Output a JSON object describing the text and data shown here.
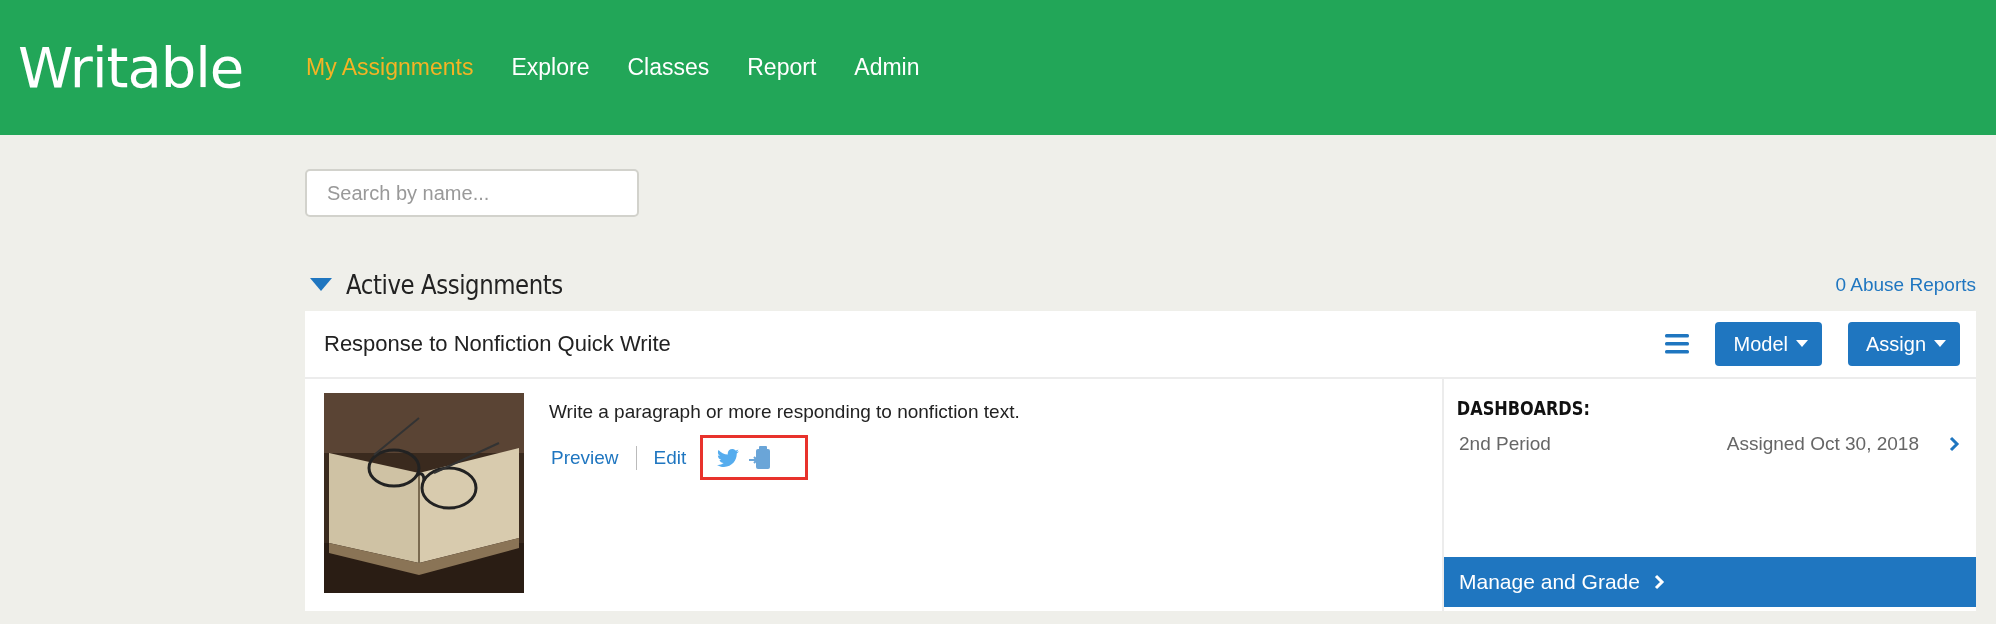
{
  "logo": "Writable",
  "nav": [
    {
      "label": "My Assignments",
      "selected": true
    },
    {
      "label": "Explore",
      "selected": false
    },
    {
      "label": "Classes",
      "selected": false
    },
    {
      "label": "Report",
      "selected": false
    },
    {
      "label": "Admin",
      "selected": false
    }
  ],
  "search": {
    "placeholder": "Search by name..."
  },
  "section": {
    "title": "Active Assignments",
    "expanded": true,
    "abuse_reports": "0 Abuse Reports"
  },
  "assignment": {
    "title": "Response to Nonfiction Quick Write",
    "buttons": [
      "Model",
      "Assign"
    ],
    "description": "Write a paragraph or more responding to nonfiction text.",
    "links": [
      "Preview",
      "Edit"
    ]
  },
  "dashboards": {
    "heading": "DASHBOARDS:",
    "items": [
      {
        "name": "2nd Period",
        "assigned": "Assigned Oct 30, 2018"
      }
    ],
    "action": "Manage and Grade"
  }
}
